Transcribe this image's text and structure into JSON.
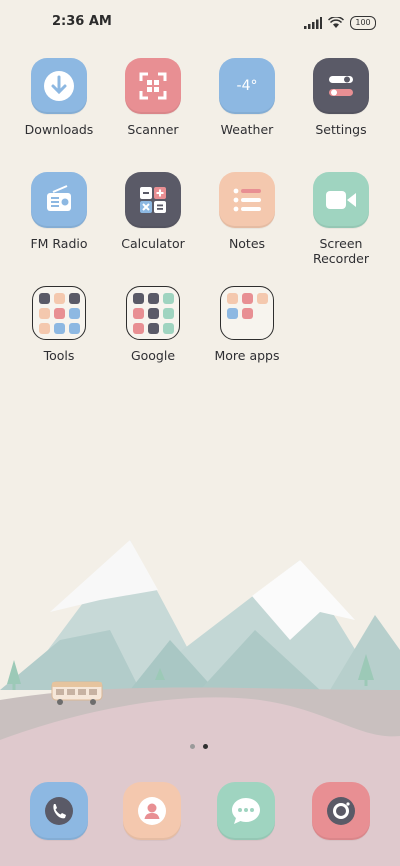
{
  "status_bar": {
    "time": "2:36 AM",
    "battery": "100"
  },
  "apps": [
    {
      "label": "Downloads"
    },
    {
      "label": "Scanner"
    },
    {
      "label": "Weather",
      "temperature": "-4°"
    },
    {
      "label": "Settings"
    },
    {
      "label": "FM Radio"
    },
    {
      "label": "Calculator"
    },
    {
      "label": "Notes"
    },
    {
      "label": "Screen\nRecorder"
    }
  ],
  "folders": [
    {
      "label": "Tools"
    },
    {
      "label": "Google"
    },
    {
      "label": "More apps"
    }
  ],
  "pager": {
    "pages": 2,
    "active": 2
  },
  "dock": [
    {
      "icon": "phone-icon"
    },
    {
      "icon": "contacts-icon"
    },
    {
      "icon": "messages-icon"
    },
    {
      "icon": "camera-icon"
    }
  ],
  "colors": {
    "blue": "#8db8e2",
    "pink": "#e88f93",
    "dark": "#5a5a67",
    "peach": "#f4c8ae",
    "mint": "#9fd4c0"
  }
}
